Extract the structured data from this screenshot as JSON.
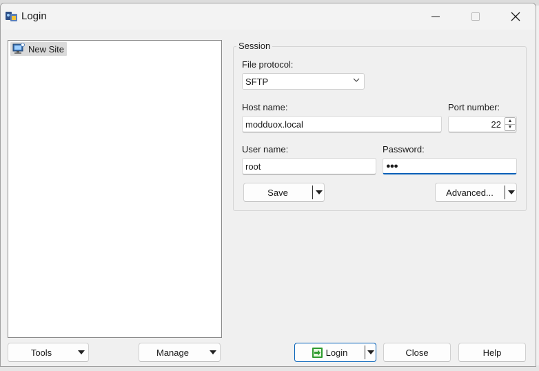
{
  "window": {
    "title": "Login"
  },
  "sites": {
    "items": [
      {
        "label": "New Site"
      }
    ]
  },
  "session": {
    "group_label": "Session",
    "file_protocol_label": "File protocol:",
    "file_protocol_value": "SFTP",
    "host_name_label": "Host name:",
    "host_name_value": "modduox.local",
    "port_label": "Port number:",
    "port_value": "22",
    "user_name_label": "User name:",
    "user_name_value": "root",
    "password_label": "Password:",
    "password_value": "●●●",
    "save_label": "Save",
    "advanced_label": "Advanced..."
  },
  "footer": {
    "tools_label": "Tools",
    "manage_label": "Manage",
    "login_label": "Login",
    "close_label": "Close",
    "help_label": "Help"
  },
  "colors": {
    "accent": "#005fb8",
    "login_icon": "#2e9b2e"
  }
}
